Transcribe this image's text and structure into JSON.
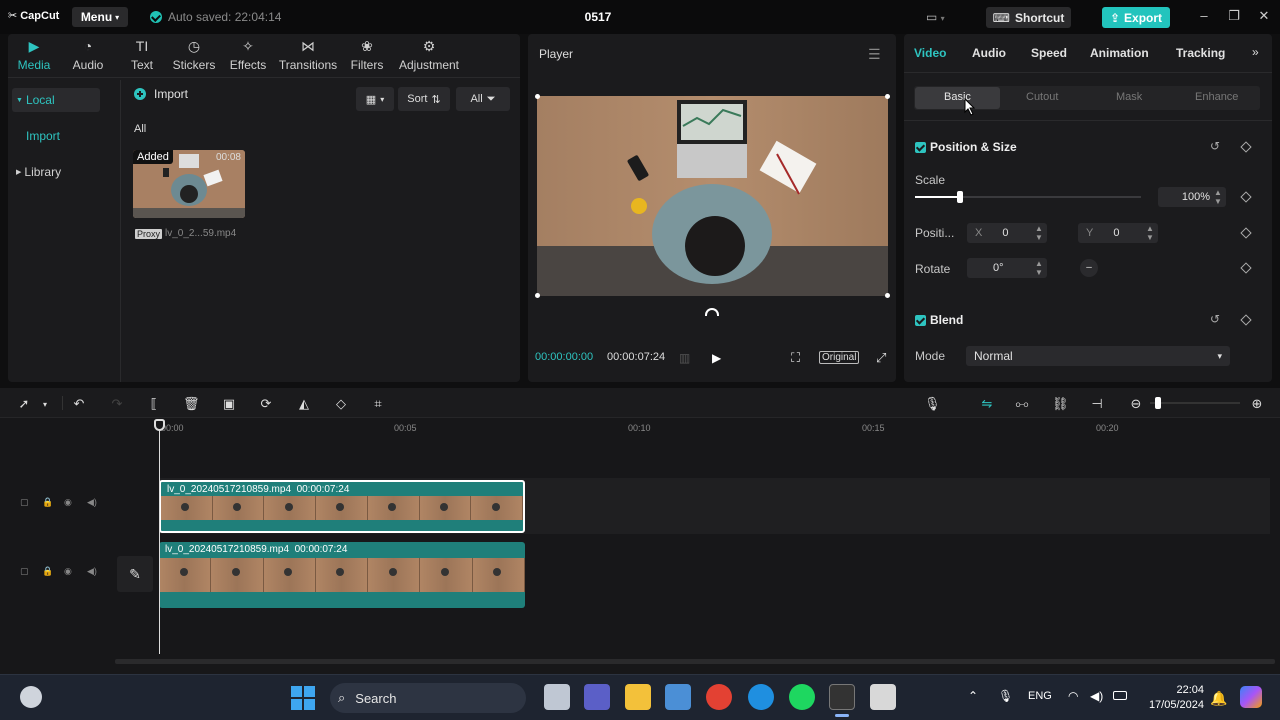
{
  "titlebar": {
    "logo": "CapCut",
    "menu_label": "Menu",
    "autosave": "Auto saved: 22:04:14",
    "project_title": "0517",
    "shortcut_label": "Shortcut",
    "export_label": "Export"
  },
  "media_tabs": [
    {
      "label": "Media",
      "icon": "media-icon"
    },
    {
      "label": "Audio",
      "icon": "audio-icon"
    },
    {
      "label": "Text",
      "icon": "text-icon"
    },
    {
      "label": "Stickers",
      "icon": "stickers-icon"
    },
    {
      "label": "Effects",
      "icon": "effects-icon"
    },
    {
      "label": "Transitions",
      "icon": "transitions-icon"
    },
    {
      "label": "Filters",
      "icon": "filters-icon"
    },
    {
      "label": "Adjustment",
      "icon": "adjustment-icon"
    }
  ],
  "media_sidebar": {
    "local": "Local",
    "import": "Import",
    "library": "Library"
  },
  "media_toolbar": {
    "import_label": "Import",
    "sort_label": "Sort",
    "all_label": "All",
    "filter_all": "All"
  },
  "media_item": {
    "badge": "Added",
    "duration": "00:08",
    "proxy": "Proxy",
    "filename": "lv_0_2...59.mp4"
  },
  "player": {
    "title": "Player",
    "current_time": "00:00:00:00",
    "total_time": "00:00:07:24",
    "original_label": "Original"
  },
  "props": {
    "tabs": [
      "Video",
      "Audio",
      "Speed",
      "Animation",
      "Tracking"
    ],
    "subtabs": [
      "Basic",
      "Cutout",
      "Mask",
      "Enhance"
    ],
    "position_size": "Position & Size",
    "scale_label": "Scale",
    "scale_value": "100%",
    "scale_fraction": 0.2,
    "position_label": "Positi...",
    "x_label": "X",
    "x_value": "0",
    "y_label": "Y",
    "y_value": "0",
    "rotate_label": "Rotate",
    "rotate_value": "0°",
    "blend": "Blend",
    "mode_label": "Mode",
    "mode_value": "Normal"
  },
  "timeline": {
    "ruler": [
      "00:00",
      "00:05",
      "00:10",
      "00:15",
      "00:20"
    ],
    "clips": [
      {
        "name": "lv_0_20240517210859.mp4",
        "duration": "00:00:07:24"
      },
      {
        "name": "lv_0_20240517210859.mp4",
        "duration": "00:00:07:24"
      }
    ]
  },
  "taskbar": {
    "search_label": "Search",
    "lang": "ENG",
    "time": "22:04",
    "date": "17/05/2024"
  },
  "colors": {
    "accent": "#22c4bd",
    "panel": "#1b1b1d",
    "clip": "#1f7f7a"
  }
}
